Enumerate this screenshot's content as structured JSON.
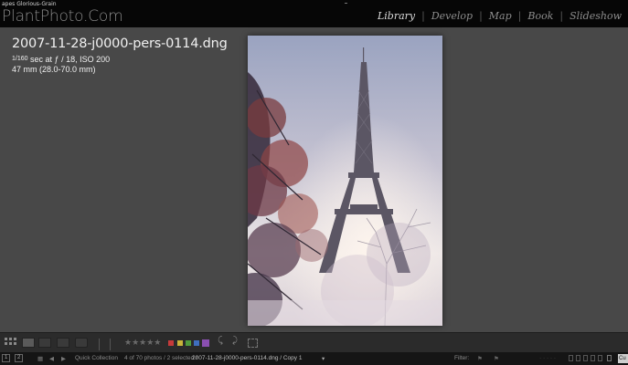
{
  "window": {
    "title": "apes Glorious-Grain"
  },
  "identity_plate": {
    "text": "PlantPhoto.Com"
  },
  "modules": {
    "items": [
      {
        "label": "Library",
        "active": true
      },
      {
        "label": "Develop",
        "active": false
      },
      {
        "label": "Map",
        "active": false
      },
      {
        "label": "Book",
        "active": false
      },
      {
        "label": "Slideshow",
        "active": false
      }
    ],
    "separator": "|"
  },
  "info_overlay": {
    "filename": "2007-11-28-j0000-pers-0114.dng",
    "shutter_numerator": "1",
    "shutter_denominator": "160",
    "exposure_rest": " sec at ƒ / 18, ISO 200",
    "lens": "47 mm (28.0-70.0 mm)"
  },
  "photo": {
    "subject": "eiffel-tower-photo"
  },
  "toolbar": {
    "stars": "★★★★★",
    "color_labels": [
      "#c63a3a",
      "#c9b43a",
      "#4f9a3c",
      "#3f6fbf",
      "#8a4fb0"
    ]
  },
  "filmstrip": {
    "page_1": "1",
    "page_2": "2",
    "source_label": "Quick Collection",
    "count_text": "4 of 70 photos / 2 selected /",
    "path_text": "2007-11-28-j0000-pers-0114.dng / Copy 1",
    "filter_label": "Filter:",
    "custom_label": "Cu"
  }
}
